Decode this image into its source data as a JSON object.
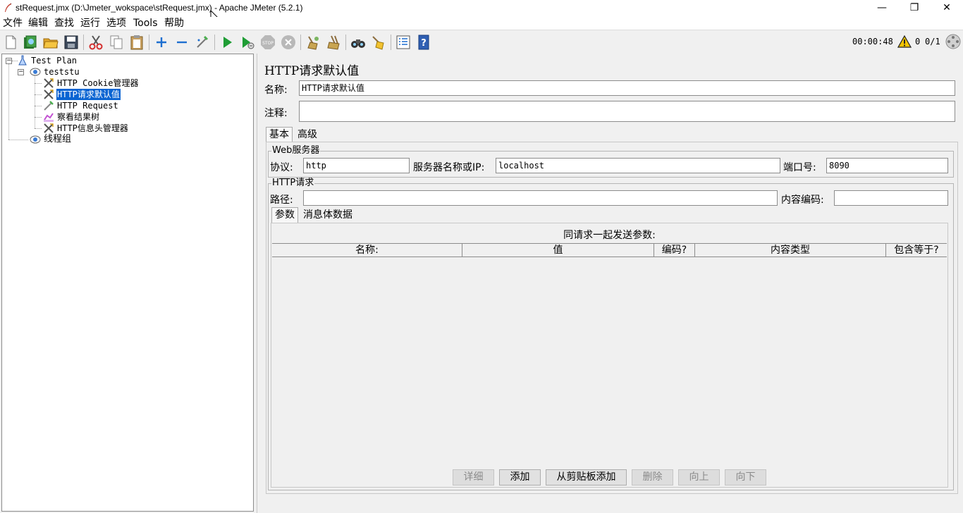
{
  "window": {
    "title": "stRequest.jmx (D:\\Jmeter_wokspace\\stRequest.jmx) - Apache JMeter (5.2.1)",
    "controls": {
      "minimize": "—",
      "maximize": "❐",
      "close": "✕"
    }
  },
  "menu": [
    "文件",
    "编辑",
    "查找",
    "运行",
    "选项",
    "Tools",
    "帮助"
  ],
  "toolbar": {
    "timer": "00:00:48",
    "warnings": "0",
    "threads": "0/1"
  },
  "tree": {
    "nodes": [
      {
        "label": "Test Plan",
        "icon": "test-plan-icon"
      },
      {
        "label": "teststu",
        "icon": "thread-group-icon"
      },
      {
        "label": "HTTP Cookie管理器",
        "icon": "config-element-icon"
      },
      {
        "label": "HTTP请求默认值",
        "icon": "config-element-icon",
        "selected": true
      },
      {
        "label": "HTTP Request",
        "icon": "sampler-icon"
      },
      {
        "label": "察看结果树",
        "icon": "listener-icon"
      },
      {
        "label": "HTTP信息头管理器",
        "icon": "config-element-icon"
      },
      {
        "label": "线程组",
        "icon": "thread-group-icon"
      }
    ]
  },
  "panel": {
    "title": "HTTP请求默认值",
    "name_label": "名称:",
    "name_value": "HTTP请求默认值",
    "comment_label": "注释:",
    "comment_value": "",
    "tabs": [
      "基本",
      "高级"
    ],
    "web_server": {
      "title": "Web服务器",
      "protocol_label": "协议:",
      "protocol_value": "http",
      "server_label": "服务器名称或IP:",
      "server_value": "localhost",
      "port_label": "端口号:",
      "port_value": "8090"
    },
    "http_request": {
      "title": "HTTP请求",
      "path_label": "路径:",
      "path_value": "",
      "encoding_label": "内容编码:",
      "encoding_value": "",
      "tabs": [
        "参数",
        "消息体数据"
      ]
    },
    "params_table": {
      "caption": "同请求一起发送参数:",
      "columns": [
        "名称:",
        "值",
        "编码?",
        "内容类型",
        "包含等于?"
      ],
      "rows": []
    },
    "buttons": [
      {
        "label": "详细",
        "enabled": false
      },
      {
        "label": "添加",
        "enabled": true
      },
      {
        "label": "从剪贴板添加",
        "enabled": true
      },
      {
        "label": "删除",
        "enabled": false
      },
      {
        "label": "向上",
        "enabled": false
      },
      {
        "label": "向下",
        "enabled": false
      }
    ]
  }
}
